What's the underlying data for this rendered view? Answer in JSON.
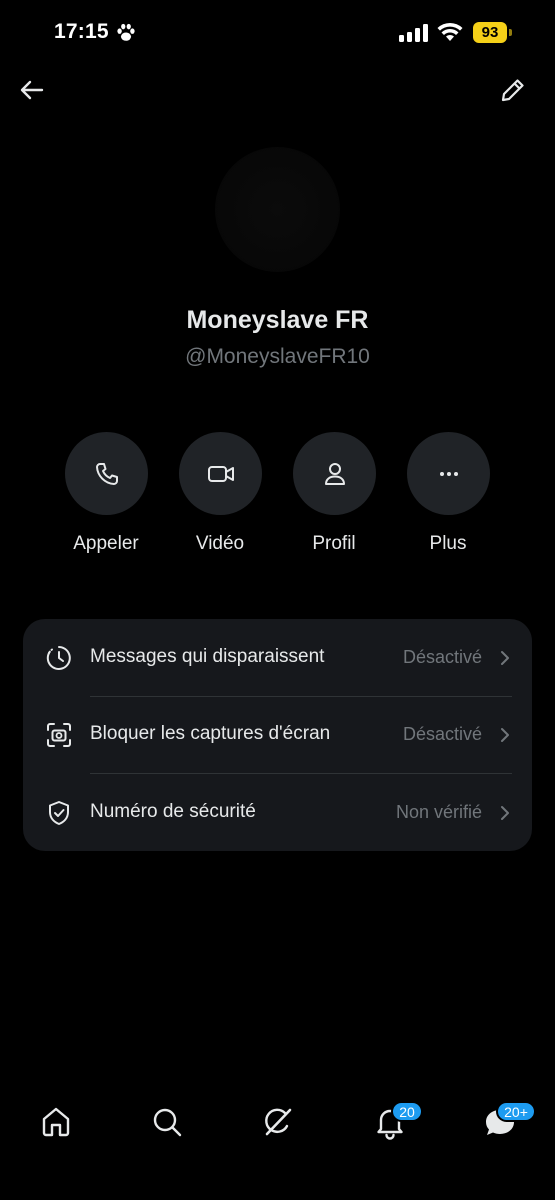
{
  "status_bar": {
    "time": "17:15",
    "battery": "93",
    "accent": "#f5d018"
  },
  "header": {
    "back_icon": "arrow-left-icon",
    "edit_icon": "pencil-icon"
  },
  "profile": {
    "name": "Moneyslave FR",
    "handle": "@MoneyslaveFR10"
  },
  "actions": [
    {
      "label": "Appeler",
      "icon": "phone-icon"
    },
    {
      "label": "Vidéo",
      "icon": "video-camera-icon"
    },
    {
      "label": "Profil",
      "icon": "person-icon"
    },
    {
      "label": "Plus",
      "icon": "more-dots-icon"
    }
  ],
  "settings": [
    {
      "label": "Messages qui disparaissent",
      "value": "Désactivé",
      "icon": "timer-icon"
    },
    {
      "label": "Bloquer les captures d'écran",
      "value": "Désactivé",
      "icon": "screenshot-camera-icon"
    },
    {
      "label": "Numéro de sécurité",
      "value": "Non vérifié",
      "icon": "shield-check-icon"
    }
  ],
  "bottom_nav": {
    "items": [
      {
        "icon": "home-icon"
      },
      {
        "icon": "search-icon"
      },
      {
        "icon": "grok-slash-icon"
      },
      {
        "icon": "bell-icon",
        "badge": "20"
      },
      {
        "icon": "messages-icon",
        "badge": "20+"
      }
    ],
    "badge_color": "#1d9bf0"
  }
}
